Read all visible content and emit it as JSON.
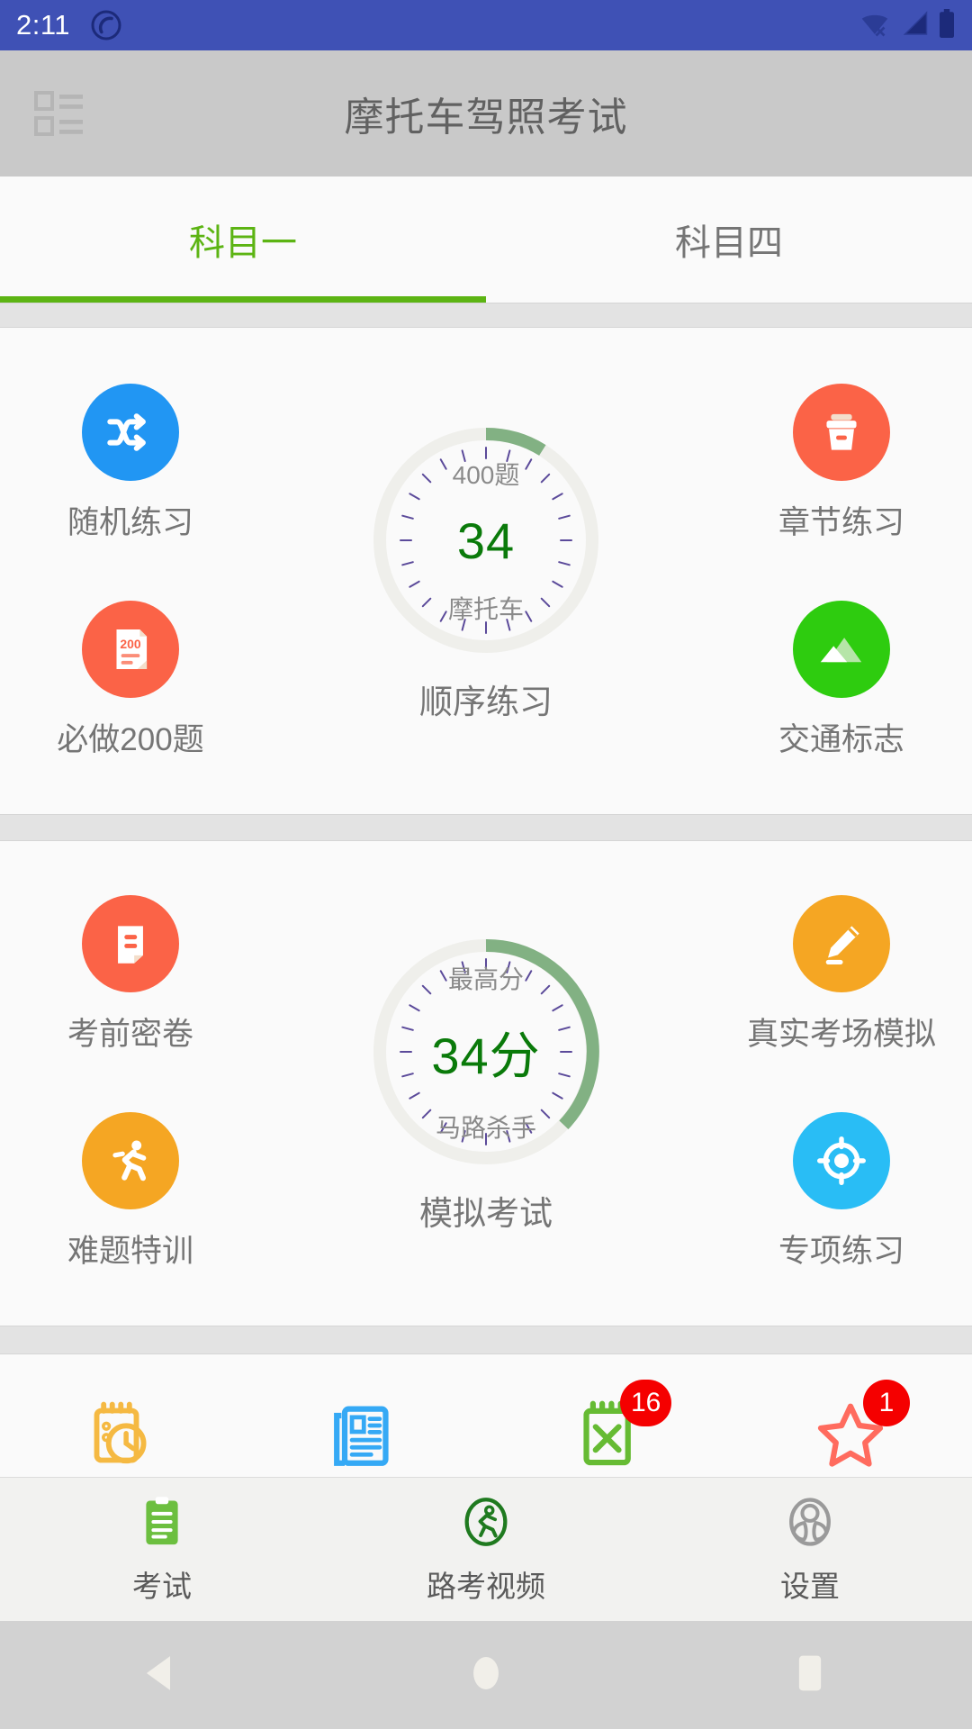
{
  "statusbar": {
    "time": "2:11",
    "icons": [
      "app-circle-icon",
      "wifi-off-icon",
      "signal-icon",
      "battery-icon"
    ]
  },
  "appbar": {
    "menu_icon": "list-menu-icon",
    "title": "摩托车驾照考试"
  },
  "tabs": [
    {
      "label": "科目一",
      "active": true
    },
    {
      "label": "科目四",
      "active": false
    }
  ],
  "section1": {
    "left": [
      {
        "label": "随机练习",
        "icon": "shuffle-icon",
        "color": "#2196f3"
      },
      {
        "label": "必做200题",
        "icon": "document-200-icon",
        "color": "#fb6347"
      }
    ],
    "right": [
      {
        "label": "章节练习",
        "icon": "archive-box-icon",
        "color": "#fb6347"
      },
      {
        "label": "交通标志",
        "icon": "mountain-icon",
        "color": "#2ecc0f"
      }
    ],
    "ring": {
      "top": "400题",
      "main": "34",
      "bottom": "摩托车",
      "caption": "顺序练习",
      "progress_pct": 8.5,
      "arc_color": "#82b183",
      "track_color": "#efefeb"
    }
  },
  "section2": {
    "left": [
      {
        "label": "考前密卷",
        "icon": "exam-paper-icon",
        "color": "#fb6347"
      },
      {
        "label": "难题特训",
        "icon": "running-icon",
        "color": "#f5a623"
      }
    ],
    "right": [
      {
        "label": "真实考场模拟",
        "icon": "pencil-icon",
        "color": "#f5a623"
      },
      {
        "label": "专项练习",
        "icon": "target-icon",
        "color": "#29bdf5"
      }
    ],
    "ring": {
      "top": "最高分",
      "main": "34分",
      "bottom": "马路杀手",
      "caption": "模拟考试",
      "progress_pct": 45,
      "arc_color": "#82b183",
      "track_color": "#efefeb"
    }
  },
  "quickrow": [
    {
      "icon": "calendar-clock-icon",
      "color": "#f5b942",
      "badge": ""
    },
    {
      "icon": "book-icon",
      "color": "#35a9f5",
      "badge": ""
    },
    {
      "icon": "notepad-x-icon",
      "color": "#66bb33",
      "badge": "16"
    },
    {
      "icon": "star-icon",
      "color": "#ff6b5e",
      "badge": "1"
    }
  ],
  "bottomnav": [
    {
      "label": "考试",
      "icon": "clipboard-icon",
      "color": "#6cbf3f",
      "active": true
    },
    {
      "label": "路考视频",
      "icon": "video-person-icon",
      "color": "#1f7a1f",
      "active": false
    },
    {
      "label": "设置",
      "icon": "steering-wheel-icon",
      "color": "#9a9a9a",
      "active": false
    }
  ],
  "androidnav": {
    "back": "back-triangle-icon",
    "home": "home-circle-icon",
    "recents": "recents-square-icon"
  }
}
